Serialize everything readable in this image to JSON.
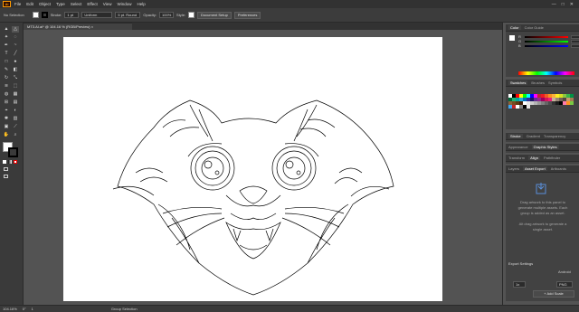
{
  "app": {
    "logo_text": "Ai",
    "menus": [
      "File",
      "Edit",
      "Object",
      "Type",
      "Select",
      "Effect",
      "View",
      "Window",
      "Help"
    ],
    "window_controls": [
      "—",
      "□",
      "✕"
    ]
  },
  "control_bar": {
    "selection_label": "No Selection",
    "stroke_label": "Stroke:",
    "stroke_weight": "1 pt",
    "stroke_profile": "Uniform",
    "brush_label": "5 pt. Round",
    "opacity_label": "Opacity:",
    "opacity_value": "100%",
    "style_label": "Style:",
    "doc_setup_button": "Document Setup",
    "preferences_button": "Preferences"
  },
  "document": {
    "tab_title": "MT3.AI.ai* @ 104.16 % (RGB/Preview)",
    "close_icon": "×"
  },
  "status_bar": {
    "zoom": "104.16%",
    "angle": "0°",
    "artboard_num": "1",
    "mode": "Group Selection"
  },
  "panels": {
    "color_tabs": [
      "Color",
      "Color Guide"
    ],
    "color_sliders": [
      "R",
      "G",
      "B"
    ],
    "swatch_tabs": [
      "Swatches",
      "Brushes",
      "Symbols"
    ],
    "stroke_tabs": [
      "Stroke",
      "Gradient",
      "Transparency"
    ],
    "appearance_tabs": [
      "Appearance",
      "Graphic Styles"
    ],
    "transform_tabs": [
      "Transform",
      "Align",
      "Pathfinder"
    ],
    "layers_tabs": [
      "Layers",
      "Asset Export",
      "Artboards"
    ],
    "asset_export_text": "Drag artwork to this panel to generate multiple assets. Each group is added as an asset.",
    "asset_export_text2": "Alt drag artwork to generate a single asset.",
    "export_settings_label": "Export Settings",
    "scale_value": "1x",
    "suffix_label": "Android",
    "format_value": "PNG",
    "add_scale_button": "+ Add Scale"
  },
  "colors": {
    "swatch_colors": [
      "#ffffff",
      "#000000",
      "#ff0000",
      "#ffff00",
      "#00ff00",
      "#00ffff",
      "#0000ff",
      "#ff00ff",
      "#c1272d",
      "#ed1c24",
      "#f15a24",
      "#f7931e",
      "#fbb03b",
      "#fcee21",
      "#d9e021",
      "#8cc63f",
      "#39b54a",
      "#009245",
      "#006837",
      "#22b573",
      "#00a99d",
      "#29abe2",
      "#0071bc",
      "#2e3192",
      "#1b1464",
      "#662d91",
      "#93278f",
      "#9e005d",
      "#d4145a",
      "#ed1e79",
      "#c7b299",
      "#998675",
      "#736357",
      "#534741",
      "#c69c6d",
      "#a67c52",
      "#8c6239",
      "#754c24",
      "#603813",
      "#42210b",
      "#ffffff",
      "#e6e6e6",
      "#cccccc",
      "#b3b3b3",
      "#999999",
      "#808080",
      "#666666",
      "#4d4d4d",
      "#333333",
      "#1a1a1a",
      "#000000",
      "#ff7bac",
      "#ff931e",
      "#7ac943",
      "#3fa9f5",
      "#c1272d",
      "#ffffff",
      "#808080",
      "#000000",
      "#e6e6e6"
    ]
  }
}
